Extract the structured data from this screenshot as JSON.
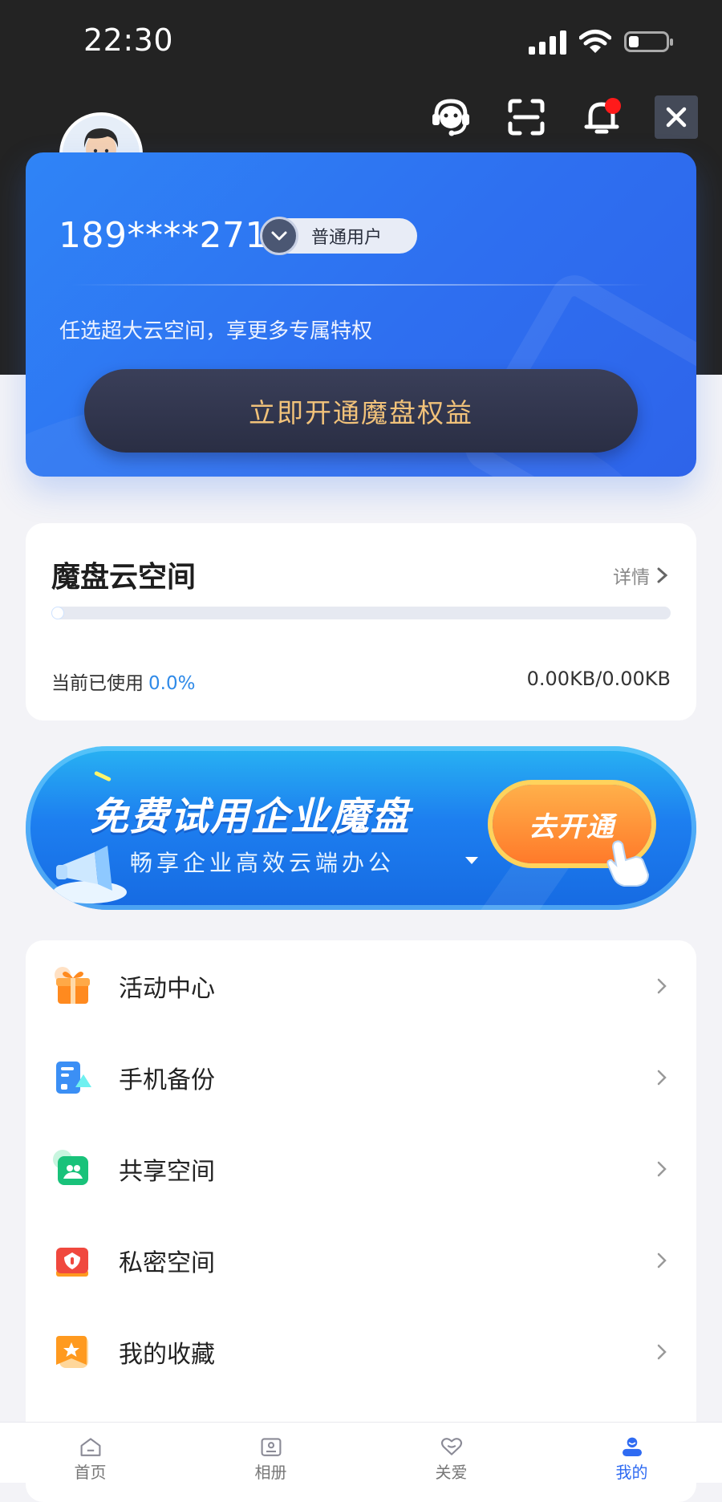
{
  "status_bar": {
    "time": "22:30"
  },
  "header_actions": [
    {
      "name": "customer-service-icon"
    },
    {
      "name": "scan-icon"
    },
    {
      "name": "bell-icon"
    },
    {
      "name": "close-icon"
    }
  ],
  "member_card": {
    "phone": "189****2711",
    "user_level": "普通用户",
    "promo_text": "任选超大云空间，享更多专属特权",
    "cta_label": "立即开通魔盘权益",
    "cta_color": "#f1c27a"
  },
  "storage": {
    "title": "魔盘云空间",
    "details_label": "详情",
    "used_label": "当前已使用",
    "used_percent": "0.0%",
    "used_fraction": 0.0,
    "usage_size": "0.00KB/0.00KB"
  },
  "banner": {
    "title": "免费试用企业魔盘",
    "subtitle": "畅享企业高效云端办公",
    "button_label": "去开通"
  },
  "menu": [
    {
      "label": "活动中心",
      "icon": "gift-icon",
      "color": "#ff8a1f"
    },
    {
      "label": "手机备份",
      "icon": "phone-backup-icon",
      "color": "#3b8ff5"
    },
    {
      "label": "共享空间",
      "icon": "shared-space-icon",
      "color": "#19c27a"
    },
    {
      "label": "私密空间",
      "icon": "private-space-icon",
      "color": "#f0483e"
    },
    {
      "label": "我的收藏",
      "icon": "favorite-icon",
      "color": "#ff9a1f"
    }
  ],
  "bottom_nav": [
    {
      "label": "首页",
      "icon": "home-icon",
      "active": false
    },
    {
      "label": "相册",
      "icon": "album-icon",
      "active": false
    },
    {
      "label": "关爱",
      "icon": "care-icon",
      "active": false
    },
    {
      "label": "我的",
      "icon": "profile-icon",
      "active": true
    }
  ],
  "colors": {
    "brand_blue": "#2f6bf2",
    "accent_blue": "#2f8ae8",
    "header_dark": "#232323"
  }
}
